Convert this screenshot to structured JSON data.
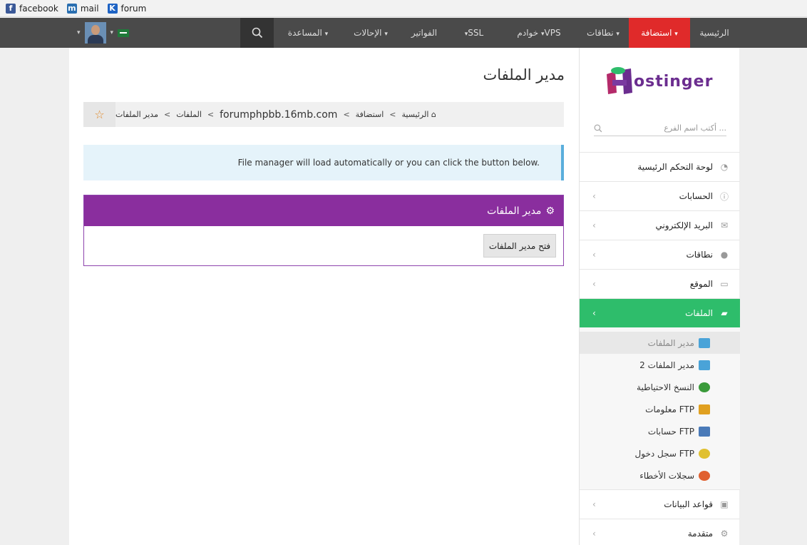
{
  "bookmarks": [
    {
      "label": "facebook",
      "icon": "facebook-icon"
    },
    {
      "label": "mail",
      "icon": "mail-icon"
    },
    {
      "label": "forum",
      "icon": "forum-icon"
    }
  ],
  "nav": {
    "home": "الرئيسية",
    "hosting": "استضافة",
    "domains": "نطاقات",
    "servers": "خوادم",
    "vps": "VPS",
    "ssl": "SSL",
    "billing": "الفواتير",
    "referrals": "الإحالات",
    "help": "المساعدة"
  },
  "sidebar": {
    "logo_text": "ostinger",
    "search_placeholder": "أكتب اسم الفرع ...",
    "menu": [
      {
        "label": "لوحة التحكم الرئيسية",
        "icon": "dashboard-icon"
      },
      {
        "label": "الحسابات",
        "icon": "info-icon"
      },
      {
        "label": "البريد الإلكتروني",
        "icon": "envelope-icon"
      },
      {
        "label": "نطاقات",
        "icon": "globe-icon"
      },
      {
        "label": "الموقع",
        "icon": "monitor-icon"
      },
      {
        "label": "الملفات",
        "icon": "folder-open-icon"
      }
    ],
    "submenu": [
      {
        "label": "مدير الملفات",
        "color": "#4aa3d8"
      },
      {
        "label": "مدير الملفات 2",
        "color": "#4aa3d8"
      },
      {
        "label": "النسخ الاحتياطية",
        "color": "#3a9a3a"
      },
      {
        "label": "معلومات FTP",
        "color": "#e0a020"
      },
      {
        "label": "حسابات FTP",
        "color": "#4a7ab8"
      },
      {
        "label": "سجل دخول FTP",
        "color": "#e0c030"
      },
      {
        "label": "سجلات الأخطاء",
        "color": "#e06030"
      }
    ],
    "menu_after": [
      {
        "label": "قواعد البيانات",
        "icon": "database-icon"
      },
      {
        "label": "متقدمة",
        "icon": "gears-icon"
      }
    ]
  },
  "main": {
    "title": "مدير الملفات",
    "breadcrumb": [
      "الرئيسية",
      "استضافة",
      "forumphpbb.16mb.com",
      "الملفات",
      "مدير الملفات"
    ],
    "alert": "File manager will load automatically or you can click the button below.",
    "panel_title": "مدير الملفات",
    "open_button": "فتح مدير الملفات"
  },
  "colors": {
    "nav_bg": "#4a4a4a",
    "nav_active": "#e02a2a",
    "sidebar_active": "#2ebd6b",
    "panel_header": "#8a2e9e",
    "alert_bg": "#e5f3fa"
  }
}
